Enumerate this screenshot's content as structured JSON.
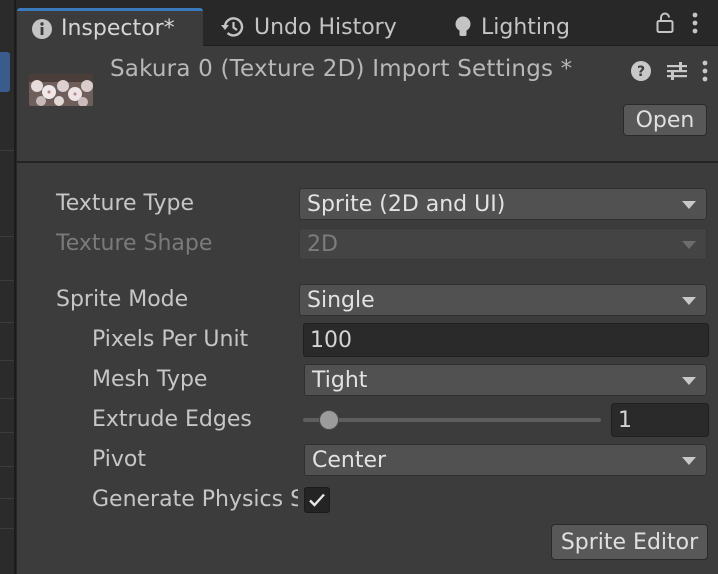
{
  "tabs": [
    {
      "label": "Inspector*",
      "icon": "info-icon",
      "active": true
    },
    {
      "label": "Undo History",
      "icon": "history-icon",
      "active": false
    },
    {
      "label": "Lighting",
      "icon": "lightbulb-icon",
      "active": false
    }
  ],
  "header": {
    "title": "Sakura 0 (Texture 2D) Import Settings *",
    "open_label": "Open"
  },
  "fields": {
    "texture_type": {
      "label": "Texture Type",
      "value": "Sprite (2D and UI)"
    },
    "texture_shape": {
      "label": "Texture Shape",
      "value": "2D"
    },
    "sprite_mode": {
      "label": "Sprite Mode",
      "value": "Single"
    },
    "pixels_per_unit": {
      "label": "Pixels Per Unit",
      "value": "100"
    },
    "mesh_type": {
      "label": "Mesh Type",
      "value": "Tight"
    },
    "extrude_edges": {
      "label": "Extrude Edges",
      "value": "1",
      "min": 0,
      "max": 32
    },
    "pivot": {
      "label": "Pivot",
      "value": "Center"
    },
    "generate_physics": {
      "label": "Generate Physics Shape",
      "checked": true
    }
  },
  "sprite_editor_label": "Sprite Editor",
  "colors": {
    "accent": "#3a79bb",
    "panel": "#3c3c3c",
    "dropdown": "#515151"
  }
}
